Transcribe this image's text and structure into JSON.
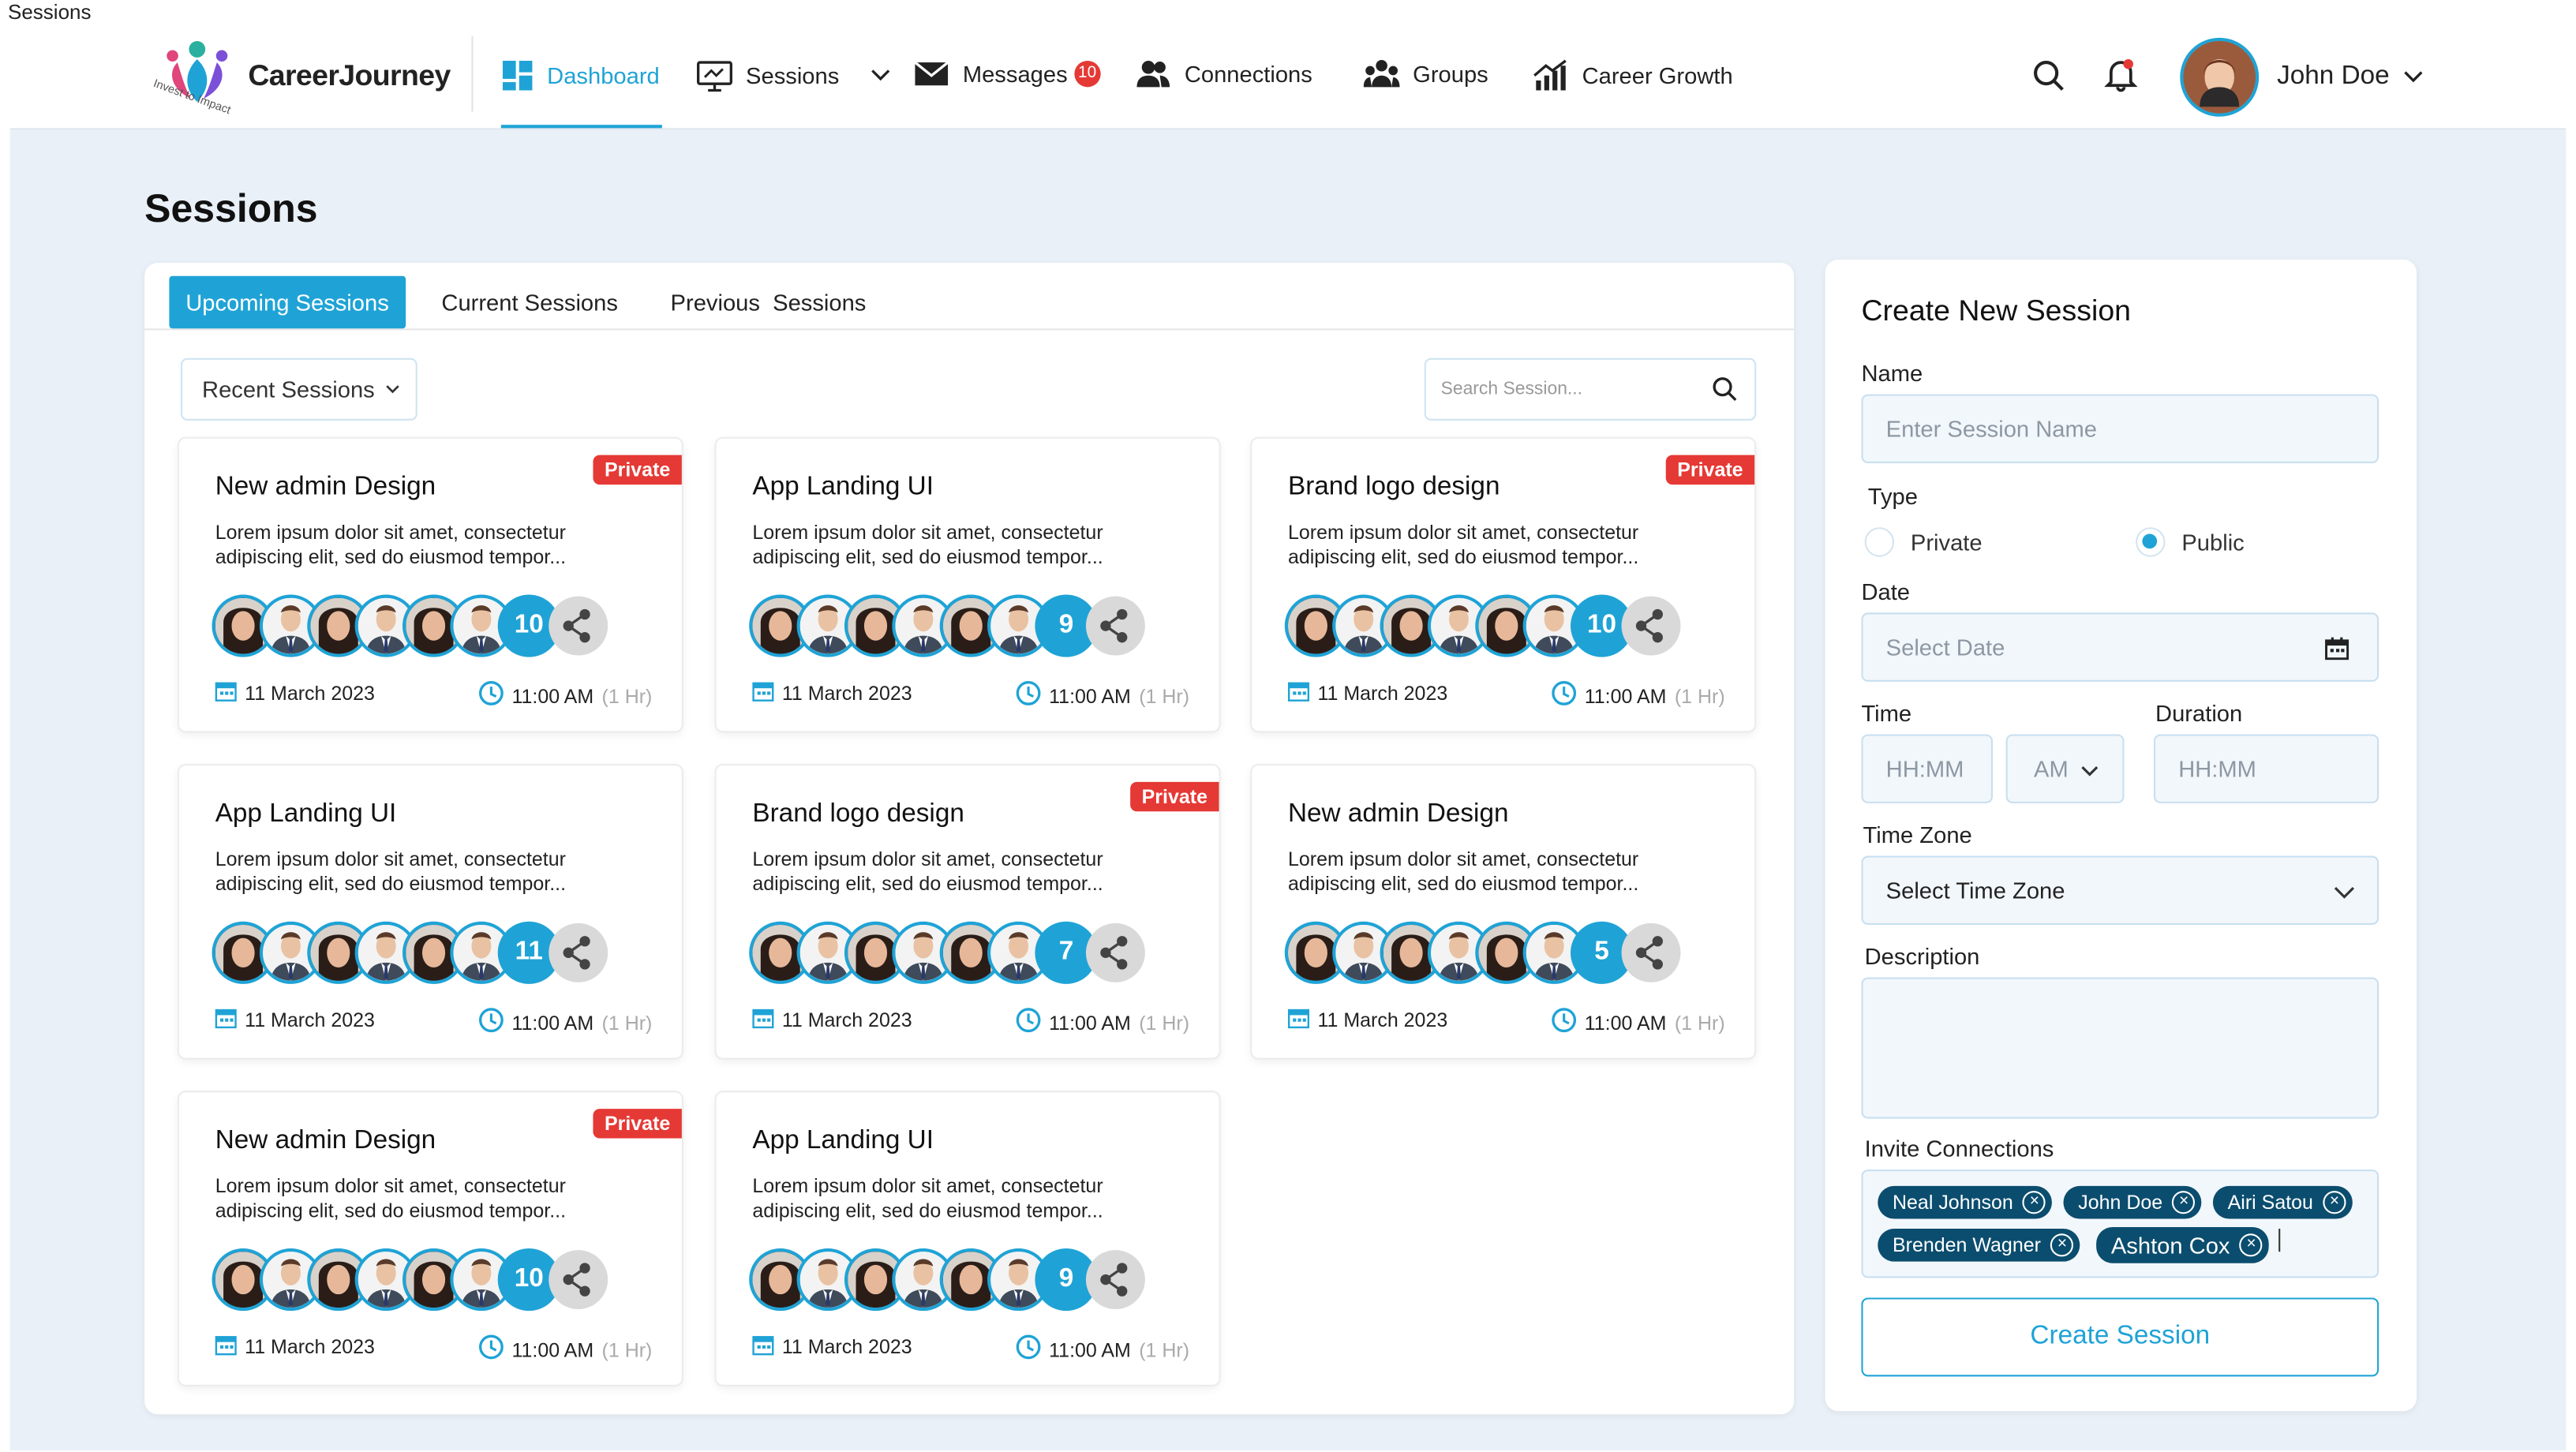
{
  "window": {
    "caption": "Sessions"
  },
  "brand": {
    "name": "CareerJourney",
    "tagline": "Invest to Impact"
  },
  "nav": {
    "dashboard": "Dashboard",
    "sessions": "Sessions",
    "messages": "Messages",
    "messages_badge": "10",
    "connections": "Connections",
    "groups": "Groups",
    "career_growth": "Career Growth"
  },
  "user": {
    "name": "John Doe"
  },
  "page": {
    "title": "Sessions"
  },
  "tabs": [
    "Upcoming Sessions",
    "Current Sessions",
    "Previous  Sessions"
  ],
  "filter": {
    "label": "Recent Sessions"
  },
  "search": {
    "placeholder": "Search Session..."
  },
  "cards": [
    {
      "title": "New admin Design",
      "desc": "Lorem ipsum dolor sit amet, consectetur adipiscing elit, sed do eiusmod tempor...",
      "private": "Private",
      "count": "10",
      "date": "11 March 2023",
      "time": "11:00 AM",
      "duration": "(1 Hr)"
    },
    {
      "title": "App Landing UI",
      "desc": "Lorem ipsum dolor sit amet, consectetur adipiscing elit, sed do eiusmod tempor...",
      "private": "",
      "count": "9",
      "date": "11 March 2023",
      "time": "11:00 AM",
      "duration": "(1 Hr)"
    },
    {
      "title": "Brand logo design",
      "desc": "Lorem ipsum dolor sit amet, consectetur adipiscing elit, sed do eiusmod tempor...",
      "private": "Private",
      "count": "10",
      "date": "11 March 2023",
      "time": "11:00 AM",
      "duration": "(1 Hr)"
    },
    {
      "title": "App Landing UI",
      "desc": "Lorem ipsum dolor sit amet, consectetur adipiscing elit, sed do eiusmod tempor...",
      "private": "",
      "count": "11",
      "date": "11 March 2023",
      "time": "11:00 AM",
      "duration": "(1 Hr)"
    },
    {
      "title": "Brand logo design",
      "desc": "Lorem ipsum dolor sit amet, consectetur adipiscing elit, sed do eiusmod tempor...",
      "private": "Private",
      "count": "7",
      "date": "11 March 2023",
      "time": "11:00 AM",
      "duration": "(1 Hr)"
    },
    {
      "title": "New admin Design",
      "desc": "Lorem ipsum dolor sit amet, consectetur adipiscing elit, sed do eiusmod tempor...",
      "private": "",
      "count": "5",
      "date": "11 March 2023",
      "time": "11:00 AM",
      "duration": "(1 Hr)"
    },
    {
      "title": "New admin Design",
      "desc": "Lorem ipsum dolor sit amet, consectetur adipiscing elit, sed do eiusmod tempor...",
      "private": "Private",
      "count": "10",
      "date": "11 March 2023",
      "time": "11:00 AM",
      "duration": "(1 Hr)"
    },
    {
      "title": "App Landing UI",
      "desc": "Lorem ipsum dolor sit amet, consectetur adipiscing elit, sed do eiusmod tempor...",
      "private": "",
      "count": "9",
      "date": "11 March 2023",
      "time": "11:00 AM",
      "duration": "(1 Hr)"
    }
  ],
  "form": {
    "title": "Create New Session",
    "name_label": "Name",
    "name_placeholder": "Enter Session Name",
    "type_label": "Type",
    "type_private": "Private",
    "type_public": "Public",
    "type_selected": "Public",
    "date_label": "Date",
    "date_placeholder": "Select Date",
    "time_label": "Time",
    "time_placeholder": "HH:MM",
    "ampm_value": "AM",
    "duration_label": "Duration",
    "duration_placeholder": "HH:MM",
    "tz_label": "Time Zone",
    "tz_value": "Select Time Zone",
    "desc_label": "Description",
    "invite_label": "Invite Connections",
    "invitees": [
      "Neal Johnson",
      "John Doe",
      "Airi Satou",
      "Brenden Wagner",
      "Ashton Cox"
    ],
    "submit": "Create Session"
  },
  "colors": {
    "accent": "#1fa3d6",
    "danger": "#e53935",
    "chip": "#0b4d6e",
    "background": "#e9f0f7"
  }
}
